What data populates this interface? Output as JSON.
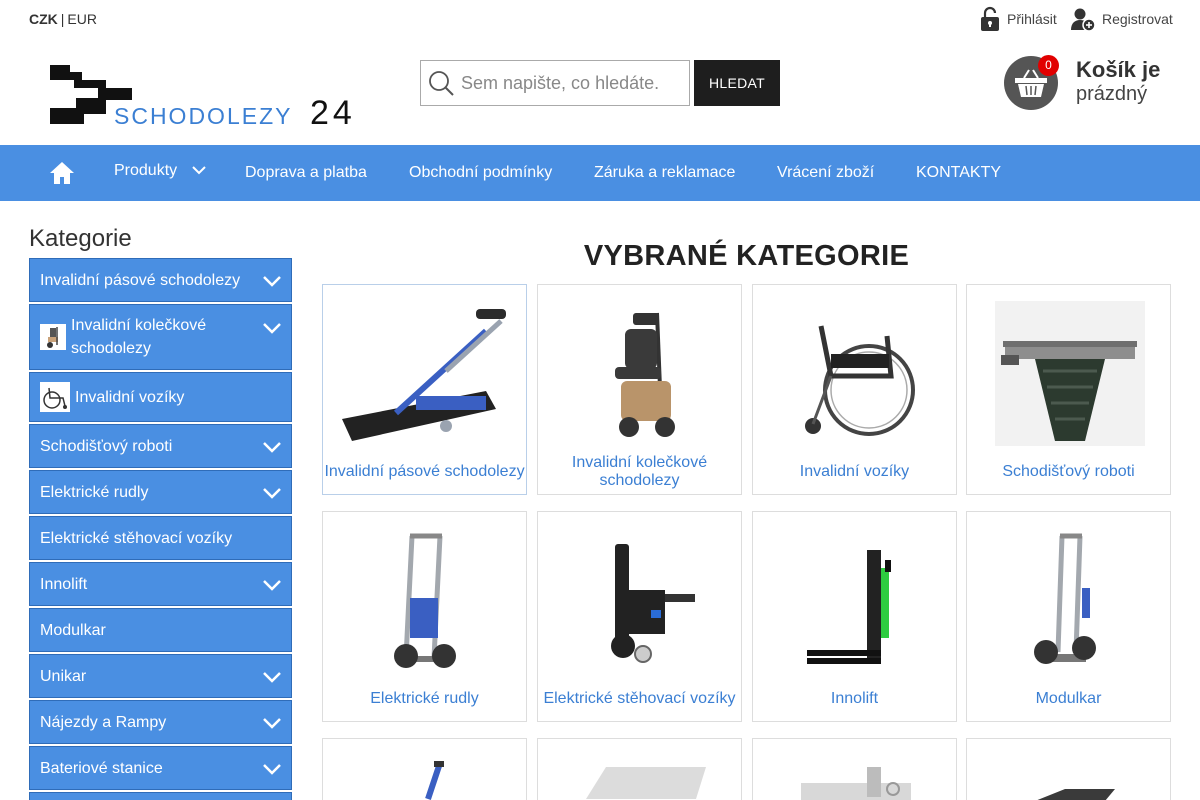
{
  "currency": {
    "selected": "CZK",
    "separator": "|",
    "other": "EUR"
  },
  "account": {
    "login": "Přihlásit",
    "register": "Registrovat"
  },
  "brand": {
    "logo_text": "SCHODOLEZY",
    "logo_number": "24"
  },
  "search": {
    "placeholder": "Sem napište, co hledáte.",
    "button": "HLEDAT"
  },
  "cart": {
    "count": "0",
    "line1": "Košík je",
    "line2": "prázdný"
  },
  "nav": {
    "home_icon": "home-icon",
    "items": [
      {
        "label": "Produkty",
        "has_dropdown": true
      },
      {
        "label": "Doprava a platba"
      },
      {
        "label": "Obchodní podmínky"
      },
      {
        "label": "Záruka a reklamace"
      },
      {
        "label": "Vrácení zboží"
      },
      {
        "label": "KONTAKTY"
      }
    ]
  },
  "sidebar": {
    "title": "Kategorie",
    "items": [
      {
        "label": "Invalidní pásové schodolezy",
        "expandable": true
      },
      {
        "label": "Invalidní kolečkové schodolezy",
        "expandable": true,
        "thumb": "stair-climber-icon"
      },
      {
        "label": "Invalidní vozíky",
        "expandable": false,
        "thumb": "wheelchair-icon"
      },
      {
        "label": "Schodišťový roboti",
        "expandable": true
      },
      {
        "label": "Elektrické rudly",
        "expandable": true
      },
      {
        "label": "Elektrické stěhovací vozíky",
        "expandable": false
      },
      {
        "label": "Innolift",
        "expandable": true
      },
      {
        "label": "Modulkar",
        "expandable": false
      },
      {
        "label": "Unikar",
        "expandable": true
      },
      {
        "label": "Nájezdy a Rampy",
        "expandable": true
      },
      {
        "label": "Bateriové stanice",
        "expandable": true
      }
    ]
  },
  "main": {
    "title": "VYBRANÉ KATEGORIE",
    "tiles": [
      {
        "label": "Invalidní pásové schodolezy",
        "icon": "tracked-stair-climber-image"
      },
      {
        "label": "Invalidní kolečkové schodolezy",
        "icon": "wheeled-stair-climber-image"
      },
      {
        "label": "Invalidní vozíky",
        "icon": "wheelchair-image"
      },
      {
        "label": "Schodišťový roboti",
        "icon": "stair-robot-image"
      },
      {
        "label": "Elektrické rudly",
        "icon": "electric-hand-truck-image"
      },
      {
        "label": "Elektrické stěhovací vozíky",
        "icon": "moving-trolley-image"
      },
      {
        "label": "Innolift",
        "icon": "lift-stacker-image"
      },
      {
        "label": "Modulkar",
        "icon": "modular-hand-truck-image"
      },
      {
        "label": "",
        "icon": "product-image"
      },
      {
        "label": "",
        "icon": "ramp-image"
      },
      {
        "label": "",
        "icon": "battery-station-image"
      },
      {
        "label": "",
        "icon": "product-image"
      }
    ]
  },
  "colors": {
    "accent": "#4a8fe2",
    "link": "#3b7fd3",
    "badge": "#e10000",
    "dark_button": "#1e1e1e"
  }
}
